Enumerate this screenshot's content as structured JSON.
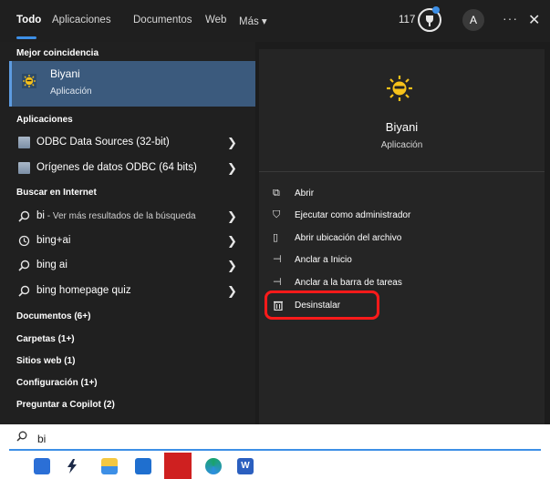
{
  "tabs": [
    {
      "label": "Todo",
      "active": true
    },
    {
      "label": "Aplicaciones"
    },
    {
      "label": "Documentos"
    },
    {
      "label": "Web"
    },
    {
      "label": "Más ▾"
    }
  ],
  "header": {
    "points": "117",
    "avatar_initial": "A",
    "more_label": "···",
    "close_label": "✕"
  },
  "left": {
    "best_match_label": "Mejor coincidencia",
    "best_match": {
      "title": "Biyani",
      "subtitle": "Aplicación"
    },
    "apps_label": "Aplicaciones",
    "apps": [
      {
        "label": "ODBC Data Sources (32-bit)"
      },
      {
        "label": "Orígenes de datos ODBC (64 bits)"
      }
    ],
    "web_label": "Buscar en Internet",
    "web": [
      {
        "bold": "bi",
        "light": " - Ver más resultados de la búsqueda",
        "icon": "search-icon"
      },
      {
        "bold": "bing+ai",
        "light": "",
        "icon": "history-icon"
      },
      {
        "bold": "bing ai",
        "light": "",
        "icon": "search-icon"
      },
      {
        "bold": "bing homepage quiz",
        "light": "",
        "icon": "search-icon"
      }
    ],
    "categories": [
      "Documentos (6+)",
      "Carpetas (1+)",
      "Sitios web (1)",
      "Configuración (1+)",
      "Preguntar a Copilot (2)"
    ]
  },
  "right": {
    "app_name": "Biyani",
    "app_type": "Aplicación",
    "actions": [
      {
        "label": "Abrir",
        "icon": "open-icon"
      },
      {
        "label": "Ejecutar como administrador",
        "icon": "shield-icon"
      },
      {
        "label": "Abrir ubicación del archivo",
        "icon": "folder-icon"
      },
      {
        "label": "Anclar a Inicio",
        "icon": "pin-icon"
      },
      {
        "label": "Anclar a la barra de tareas",
        "icon": "pin-icon"
      },
      {
        "label": "Desinstalar",
        "icon": "trash-icon"
      }
    ]
  },
  "search": {
    "value": "bi"
  },
  "colors": {
    "accent": "#3d8fe6",
    "selection": "#3b5a7d",
    "highlight": "#ff1a1a"
  }
}
